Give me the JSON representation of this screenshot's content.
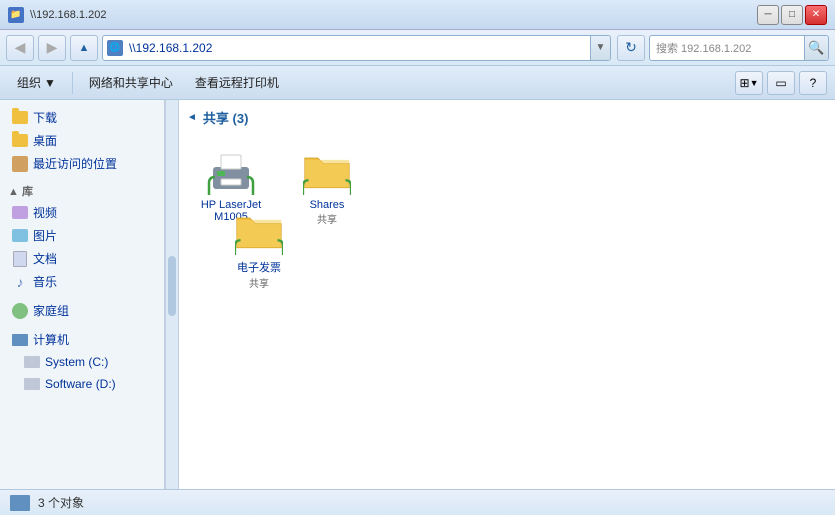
{
  "titleBar": {
    "text": "\\\\192.168.1.202",
    "minBtn": "─",
    "maxBtn": "□",
    "closeBtn": "✕"
  },
  "addressBar": {
    "path": "\\\\192.168.1.202",
    "searchPlaceholder": "搜索 192.168.1.202",
    "refreshSymbol": "↻",
    "dropdownSymbol": "▼",
    "backSymbol": "◀",
    "forwardSymbol": "▶"
  },
  "toolbar": {
    "organizeLabel": "组织",
    "networkCenterLabel": "网络和共享中心",
    "remotePrintLabel": "查看远程打印机",
    "dropdownSymbol": "▼",
    "helpSymbol": "?"
  },
  "sidebar": {
    "sections": [
      {
        "items": [
          {
            "id": "download",
            "label": "下载",
            "type": "folder"
          },
          {
            "id": "desktop",
            "label": "桌面",
            "type": "folder"
          },
          {
            "id": "recent",
            "label": "最近访问的位置",
            "type": "recent"
          }
        ]
      },
      {
        "label": "库",
        "items": [
          {
            "id": "video",
            "label": "视频",
            "type": "library"
          },
          {
            "id": "picture",
            "label": "图片",
            "type": "library"
          },
          {
            "id": "document",
            "label": "文档",
            "type": "library"
          },
          {
            "id": "music",
            "label": "音乐",
            "type": "music"
          }
        ]
      },
      {
        "items": [
          {
            "id": "homegroup",
            "label": "家庭组",
            "type": "homegroup"
          }
        ]
      },
      {
        "items": [
          {
            "id": "computer",
            "label": "计算机",
            "type": "computer"
          },
          {
            "id": "sysc",
            "label": "System (C:)",
            "type": "drive"
          },
          {
            "id": "softd",
            "label": "Software (D:)",
            "type": "drive"
          }
        ]
      }
    ]
  },
  "content": {
    "sectionTitle": "共享 (3)",
    "sectionArrow": "◄",
    "items": [
      {
        "id": "printer",
        "name": "HP LaserJet M1005",
        "sub": "",
        "type": "printer"
      },
      {
        "id": "shares-folder",
        "name": "Shares",
        "sub": "共享",
        "type": "folder"
      },
      {
        "id": "eform-folder",
        "name": "电子发票",
        "sub": "共享",
        "type": "folder"
      }
    ]
  },
  "statusBar": {
    "text": "3 个对象"
  }
}
